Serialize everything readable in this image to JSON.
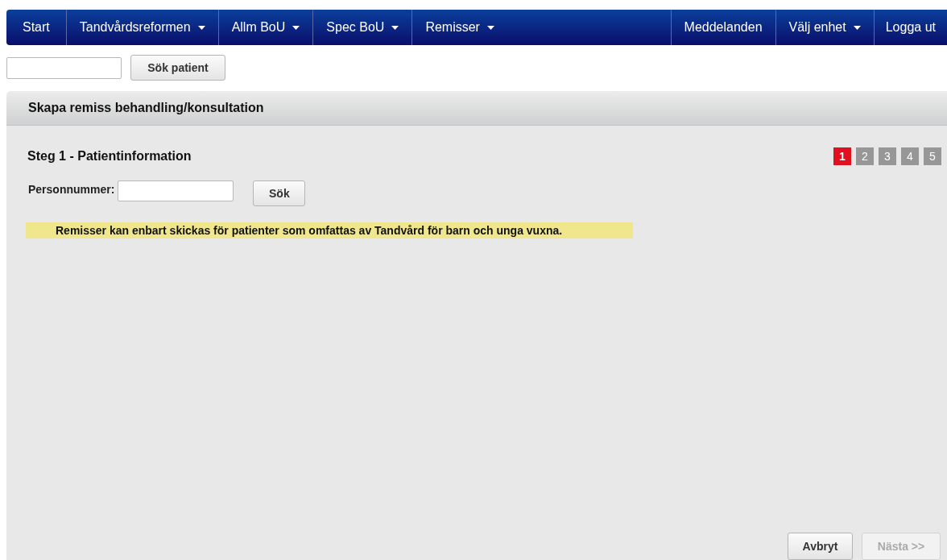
{
  "nav": {
    "left": [
      {
        "label": "Start",
        "dropdown": false
      },
      {
        "label": "Tandvårdsreformen",
        "dropdown": true
      },
      {
        "label": "Allm BoU",
        "dropdown": true
      },
      {
        "label": "Spec BoU",
        "dropdown": true
      },
      {
        "label": "Remisser",
        "dropdown": true
      }
    ],
    "right": [
      {
        "label": "Meddelanden",
        "dropdown": false
      },
      {
        "label": "Välj enhet",
        "dropdown": true
      },
      {
        "label": "Logga ut",
        "dropdown": false
      }
    ]
  },
  "patient_search": {
    "button": "Sök patient"
  },
  "panel": {
    "title": "Skapa remiss behandling/konsultation",
    "step_title": "Steg 1 - Patientinformation",
    "steps": [
      {
        "label": "1",
        "selected": true
      },
      {
        "label": "2",
        "selected": false
      },
      {
        "label": "3",
        "selected": false
      },
      {
        "label": "4",
        "selected": false
      },
      {
        "label": "5",
        "selected": false
      }
    ],
    "personnummer_label": "Personnummer:",
    "search_button": "Sök",
    "notice": "Remisser kan enbart skickas för patienter som omfattas av Tandvård för barn och unga vuxna.",
    "buttons": [
      {
        "label": "Avbryt",
        "disabled": false
      },
      {
        "label": "Nästa >>",
        "disabled": true
      }
    ]
  }
}
